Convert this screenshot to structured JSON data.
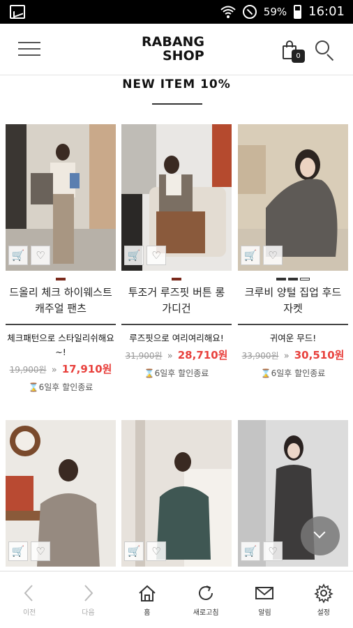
{
  "status_bar": {
    "battery": "59%",
    "time": "16:01"
  },
  "header": {
    "logo_line1": "RABANG",
    "logo_line2": "SHOP",
    "cart_count": "0"
  },
  "section": {
    "title": "NEW ITEM 10%"
  },
  "products": [
    {
      "name": "드올리 체크 하이웨스트 캐주얼 팬츠",
      "desc": "체크패턴으로 스타일리쉬해요~!",
      "old_price": "19,900원",
      "new_price": "17,910원",
      "timer": "6일후 할인종료"
    },
    {
      "name": "투조거 루즈핏 버튼 롱 가디건",
      "desc": "루즈핏으로 여리여리해요!",
      "old_price": "31,900원",
      "new_price": "28,710원",
      "timer": "6일후 할인종료"
    },
    {
      "name": "크루비 양털 집업 후드 자켓",
      "desc": "귀여운 무드!",
      "old_price": "33,900원",
      "new_price": "30,510원",
      "timer": "6일후 할인종료"
    },
    {
      "name": "",
      "desc": "",
      "old_price": "",
      "new_price": "",
      "timer": ""
    },
    {
      "name": "",
      "desc": "",
      "old_price": "",
      "new_price": "",
      "timer": ""
    },
    {
      "name": "",
      "desc": "",
      "old_price": "",
      "new_price": "",
      "timer": ""
    }
  ],
  "icons": {
    "cart": "cart-icon",
    "heart": "heart-icon",
    "hourglass": "hourglass-icon"
  },
  "symbols": {
    "arrow": "»",
    "hourglass": "⌛"
  },
  "bottom_nav": [
    {
      "label": "이전"
    },
    {
      "label": "다음"
    },
    {
      "label": "홈"
    },
    {
      "label": "새로고침"
    },
    {
      "label": "알림"
    },
    {
      "label": "설정"
    }
  ],
  "colors": {
    "sale_price": "#e8413d",
    "accent_dot": "#7a2a1c"
  }
}
